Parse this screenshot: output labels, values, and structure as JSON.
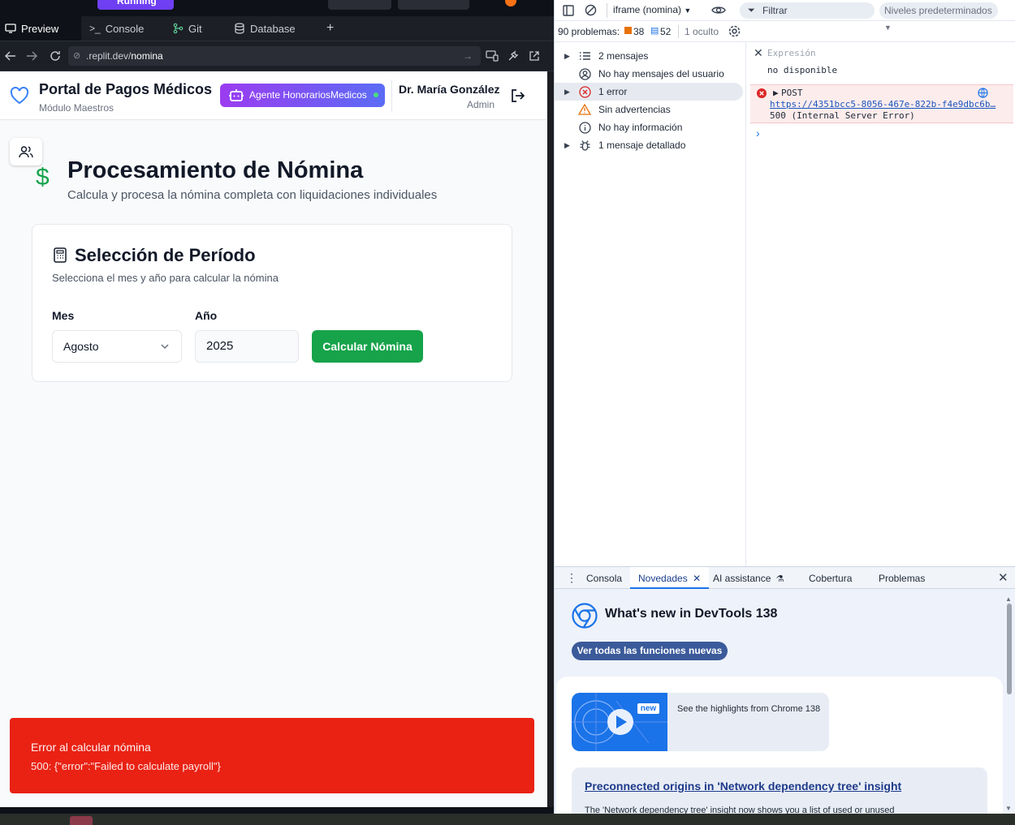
{
  "replit": {
    "running_label": "Running",
    "tabs": [
      "Preview",
      "Console",
      "Git",
      "Database"
    ],
    "add_tab": "+",
    "url_prefix": ".replit.dev/",
    "url_path": "nomina"
  },
  "app": {
    "portal_title": "Portal de Pagos Médicos",
    "portal_subtitle": "Módulo Maestros",
    "agent_button": "Agente HonorariosMedicos",
    "user_name": "Dr. María González",
    "user_role": "Admin",
    "page_title": "Procesamiento de Nómina",
    "page_subtitle": "Calcula y procesa la nómina completa con liquidaciones individuales",
    "card_title": "Selección de Período",
    "card_subtitle": "Selecciona el mes y año para calcular la nómina",
    "month_label": "Mes",
    "month_value": "Agosto",
    "year_label": "Año",
    "year_value": "2025",
    "calculate_button": "Calcular Nómina",
    "toast_title": "Error al calcular nómina",
    "toast_body": "500: {\"error\":\"Failed to calculate payroll\"}",
    "colors": {
      "accent_green": "#16a34a",
      "toast_red": "#e92214",
      "agent_gradient_start": "#9b3cf0",
      "agent_gradient_end": "#5b6cf5"
    }
  },
  "devtools": {
    "frame_select": "iframe (nomina)",
    "filter_placeholder": "Filtrar",
    "levels": "Niveles predeterminados",
    "issues_count": "90 problemas:",
    "issues_warnings": "38",
    "issues_info": "52",
    "hidden": "1 oculto",
    "sidebar": [
      {
        "label": "2 mensajes",
        "icon": "list-icon",
        "expandable": true
      },
      {
        "label": "No hay mensajes del usuario",
        "icon": "user-icon",
        "expandable": false
      },
      {
        "label": "1 error",
        "icon": "error-icon",
        "expandable": true
      },
      {
        "label": "Sin advertencias",
        "icon": "warning-icon",
        "expandable": false
      },
      {
        "label": "No hay información",
        "icon": "info-icon",
        "expandable": false
      },
      {
        "label": "1 mensaje detallado",
        "icon": "bug-icon",
        "expandable": true
      }
    ],
    "expression_label": "Expresión",
    "expression_value": "no disponible",
    "error_method": "POST",
    "error_url": "https://4351bcc5-8056-467e-822b-f4e9dbc6b…",
    "error_status": "500 (Internal Server Error)",
    "prompt_symbol": "›",
    "drawer_tabs": [
      "Consola",
      "Novedades",
      "AI assistance",
      "Cobertura",
      "Problemas"
    ],
    "whats_new_title": "What's new in DevTools 138",
    "whats_new_button": "Ver todas las funciones nuevas",
    "highlights_badge": "new",
    "highlights_text": "See the highlights from Chrome 138",
    "preconnect_title": "Preconnected origins in 'Network dependency tree' insight",
    "preconnect_body": "The 'Network dependency tree' insight now shows you a list of used or unused"
  }
}
